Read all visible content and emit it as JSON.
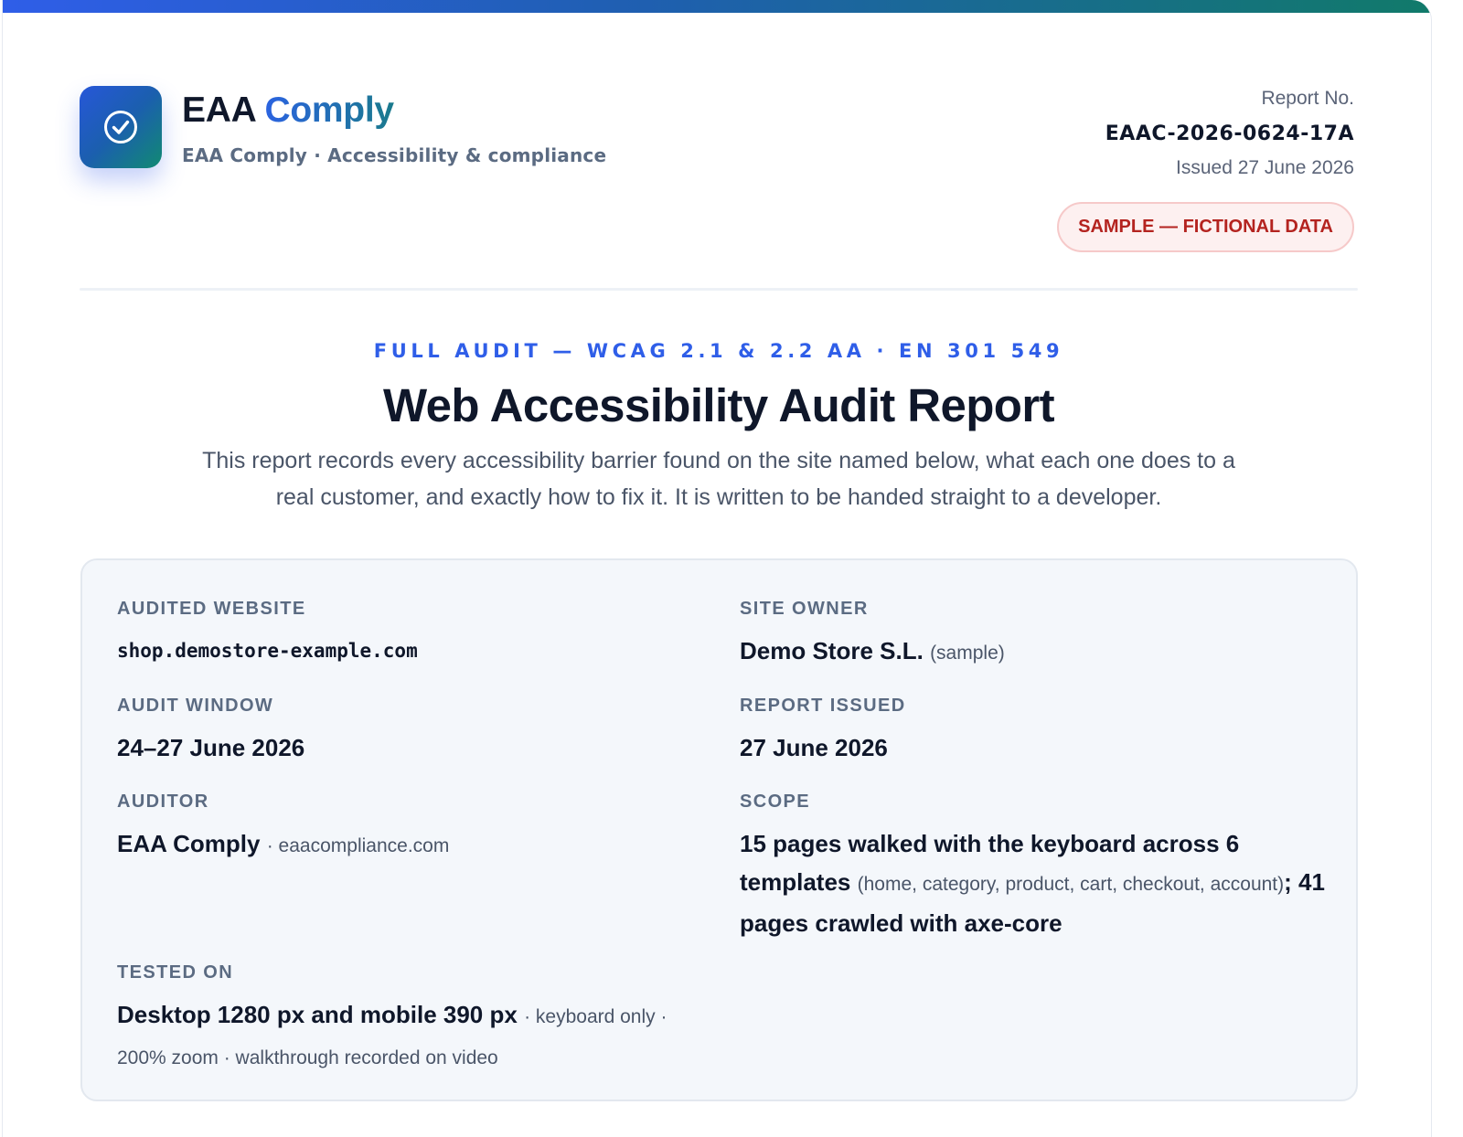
{
  "brand": {
    "name_part1": "EAA",
    "name_part2": "Comply",
    "subtitle": "EAA Comply · Accessibility & compliance",
    "logo_icon": "check-circle-icon",
    "colors": {
      "primary": "#2f5ee8",
      "secondary": "#117a6a"
    }
  },
  "report": {
    "number_label": "Report No.",
    "number": "EAAC-2026-0624-17A",
    "issued": "Issued 27 June 2026",
    "badge": "SAMPLE — FICTIONAL DATA"
  },
  "heading": {
    "eyebrow": "FULL AUDIT — WCAG 2.1 & 2.2 AA · EN 301 549",
    "title": "Web Accessibility Audit Report",
    "intro": "This report records every accessibility barrier found on the site named below, what each one does to a real customer, and exactly how to fix it. It is written to be handed straight to a developer."
  },
  "details": {
    "website_label": "AUDITED WEBSITE",
    "website": "shop.demostore-example.com",
    "owner_label": "SITE OWNER",
    "owner": "Demo Store S.L.",
    "owner_note": "(sample)",
    "window_label": "AUDIT WINDOW",
    "window": "24–27 June 2026",
    "issued_label": "REPORT ISSUED",
    "issued": "27 June 2026",
    "auditor_label": "AUDITOR",
    "auditor": "EAA Comply",
    "auditor_note": "· eaacompliance.com",
    "scope_label": "SCOPE",
    "scope_main": "15 pages walked with the keyboard across 6 templates",
    "scope_note": "(home, category, product, cart, checkout, account)",
    "scope_sep": ";",
    "scope_tail": "41 pages crawled with axe-core",
    "tested_label": "TESTED ON",
    "tested_main": "Desktop 1280 px and mobile 390 px",
    "tested_note": "· keyboard only · 200% zoom · walkthrough recorded on video"
  }
}
